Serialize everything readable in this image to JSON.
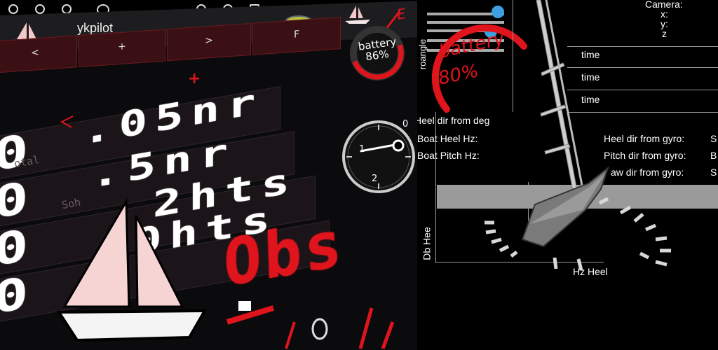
{
  "app": {
    "title": "ykpilot"
  },
  "nav_buttons": [
    "<",
    "+",
    ">",
    "F"
  ],
  "battery_left": {
    "label": "battery",
    "value": "86%"
  },
  "displays": {
    "row1": ".05nr",
    "row2": ".5nr",
    "row3": "2hts",
    "row4": "0hts",
    "big": "Obs"
  },
  "faint_labels": [
    "otal",
    "Soh"
  ],
  "gauge": {
    "ticks": [
      "0",
      "1",
      "2"
    ]
  },
  "red_marks": {
    "e": "E",
    "f": "F",
    "plus": "+",
    "s": "S"
  },
  "battery_right": {
    "label": "battery",
    "value": "80%"
  },
  "debug": {
    "camera": "Camera:",
    "x": "x:",
    "y": "y:",
    "z": "z",
    "rangle": "roangle",
    "time_labels": [
      "time",
      "time",
      "time"
    ],
    "heel_dir_from_deg": "Heel dir from deg",
    "boat_heel_hz": "Boat Heel Hz:",
    "boat_pitch_hz": "Boat Pitch Hz:",
    "heel_dir_from_gyro": "Heel dir from gyro:",
    "pitch_dir_from_gyro": "Pitch dir from gyro:",
    "yaw_dir_from_gyro": "aw dir from gyro:",
    "gyro_value_1": "S",
    "gyro_value_2": "B",
    "gyro_value_3": "S",
    "db_heel": "Db Hee",
    "hz_heel": "Hz Heel"
  },
  "colors": {
    "accent_red": "#e0141c",
    "panel_dark": "#1b1418",
    "sail_pink": "#f6d4d4",
    "hull_white": "#f4f4f4"
  }
}
